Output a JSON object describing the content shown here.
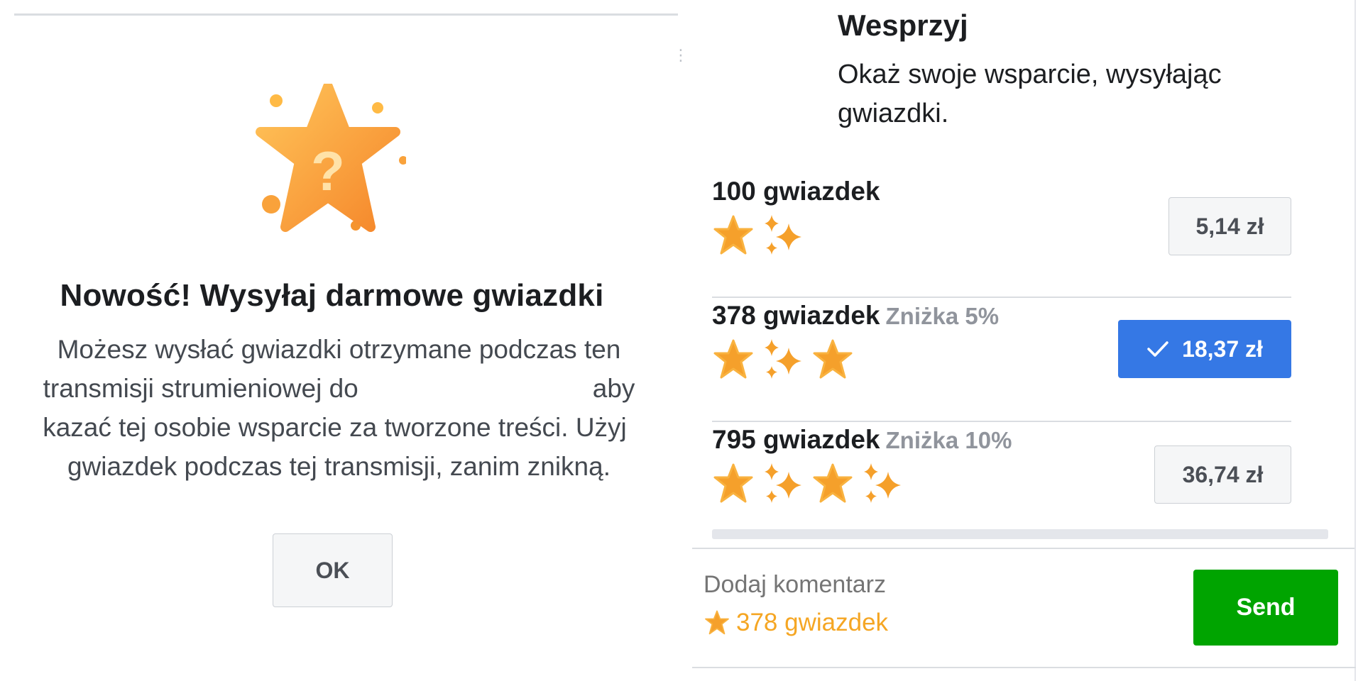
{
  "modal": {
    "title": "Nowość! Wysyłaj darmowe gwiazdki",
    "body_lines": [
      "Możesz wysłać gwiazdki otrzymane podczas ten",
      "aby",
      "transmisji strumieniowej do",
      "kazać tej osobie wsparcie za tworzone treści. Użyj",
      "gwiazdek podczas tej transmisji, zanim znikną."
    ],
    "ok_label": "OK",
    "hero_icon": "star-question-icon"
  },
  "support": {
    "title": "Wesprzyj",
    "subtitle": "Okaż swoje wsparcie, wysyłając gwiazdki.",
    "options": [
      {
        "label": "100 gwiazdek",
        "discount": "",
        "price": "5,14 zł",
        "selected": false,
        "icons": [
          "star-icon",
          "sparkle-icon"
        ]
      },
      {
        "label": "378 gwiazdek",
        "discount": "Zniżka 5%",
        "price": "18,37 zł",
        "selected": true,
        "icons": [
          "star-icon",
          "sparkle-icon",
          "star-icon"
        ]
      },
      {
        "label": "795 gwiazdek",
        "discount": "Zniżka 10%",
        "price": "36,74 zł",
        "selected": false,
        "icons": [
          "star-icon",
          "sparkle-icon",
          "star-icon",
          "sparkle-icon"
        ]
      }
    ],
    "comment_placeholder": "Dodaj komentarz",
    "selected_summary": "378 gwiazdek",
    "send_label": "Send"
  },
  "colors": {
    "selected_blue": "#3578e5",
    "send_green": "#00a400",
    "star_orange": "#f5a623"
  }
}
